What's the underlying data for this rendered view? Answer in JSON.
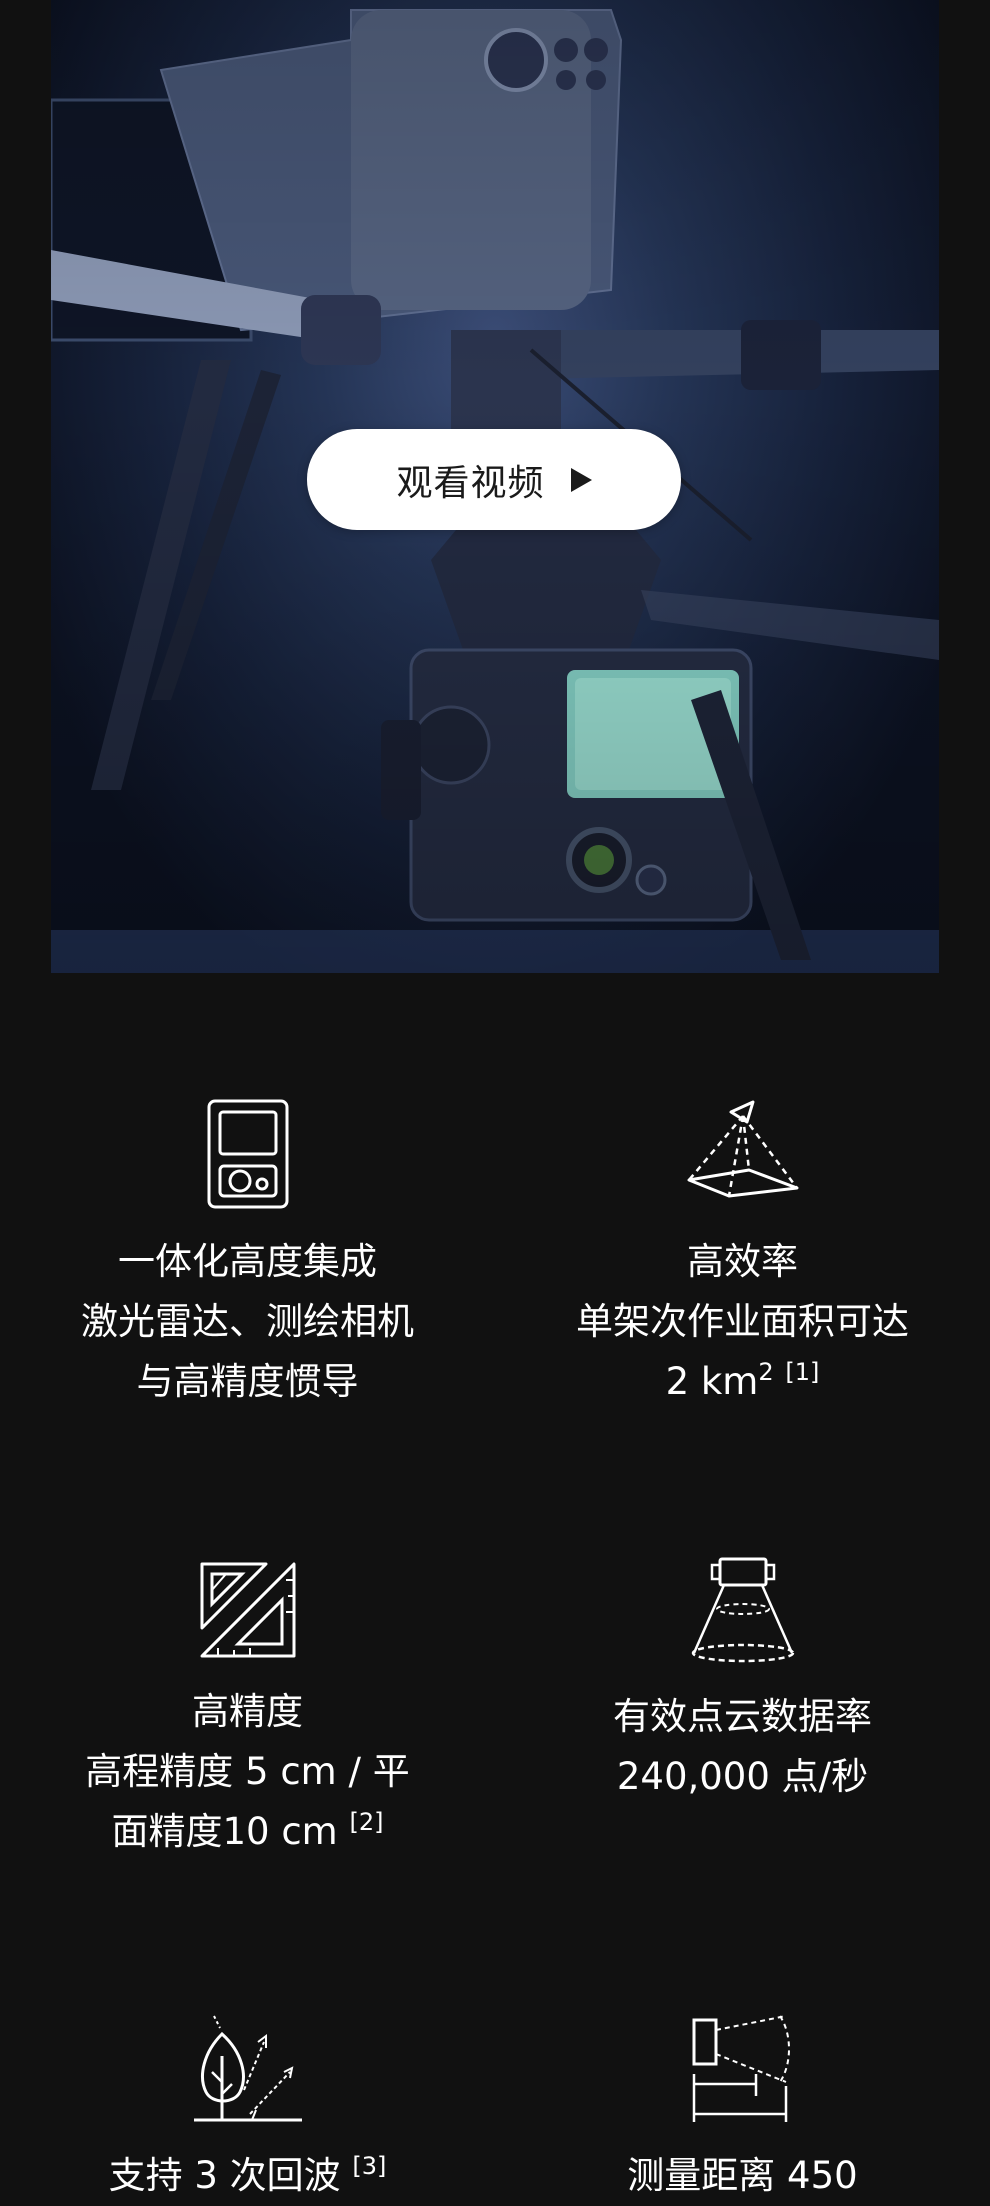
{
  "hero": {
    "watch_label": "观看视频",
    "play_icon": "play-icon",
    "image": "drone-lidar-payload"
  },
  "features": [
    {
      "icon": "integrated-device-icon",
      "title": "一体化高度集成",
      "lines": [
        "激光雷达、测绘相机",
        "与高精度惯导"
      ],
      "sup": ""
    },
    {
      "icon": "area-pyramid-icon",
      "title": "高效率",
      "lines": [
        "单架次作业面积可达"
      ],
      "value": "2 km",
      "unit_sup": "2",
      "sup": "[1]"
    },
    {
      "icon": "set-square-icon",
      "title": "高精度",
      "lines": [
        "高程精度 5 cm / 平",
        "面精度10 cm"
      ],
      "sup": "[2]"
    },
    {
      "icon": "lidar-beam-icon",
      "title": "有效点云数据率",
      "lines": [
        "240,000 点/秒"
      ],
      "sup": ""
    },
    {
      "icon": "tree-echo-icon",
      "title": "支持 3 次回波",
      "sup": "[3]"
    },
    {
      "icon": "range-measure-icon",
      "title": "测量距离 450"
    }
  ]
}
